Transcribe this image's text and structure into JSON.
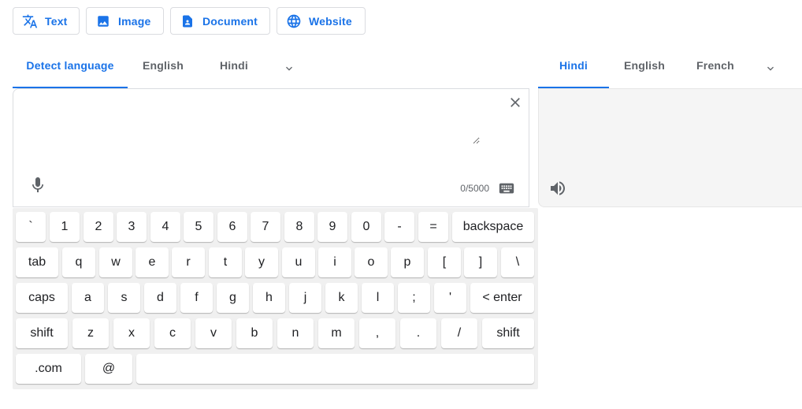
{
  "modes": [
    {
      "label": "Text",
      "icon": "translate-icon"
    },
    {
      "label": "Image",
      "icon": "image-icon"
    },
    {
      "label": "Document",
      "icon": "document-icon"
    },
    {
      "label": "Website",
      "icon": "globe-icon"
    }
  ],
  "source_tabs": [
    "Detect language",
    "English",
    "Hindi"
  ],
  "target_tabs": [
    "Hindi",
    "English",
    "French"
  ],
  "source": {
    "value": "",
    "counter": "0/5000"
  },
  "keyboard": {
    "row1": [
      "`",
      "1",
      "2",
      "3",
      "4",
      "5",
      "6",
      "7",
      "8",
      "9",
      "0",
      "-",
      "=",
      "backspace"
    ],
    "row2": [
      "tab",
      "q",
      "w",
      "e",
      "r",
      "t",
      "y",
      "u",
      "i",
      "o",
      "p",
      "[",
      "]",
      "\\"
    ],
    "row3": [
      "caps",
      "a",
      "s",
      "d",
      "f",
      "g",
      "h",
      "j",
      "k",
      "l",
      ";",
      "'",
      "< enter"
    ],
    "row4": [
      "shift",
      "z",
      "x",
      "c",
      "v",
      "b",
      "n",
      "m",
      ",",
      ".",
      "/",
      "shift"
    ],
    "row5": [
      ".com",
      "@",
      ""
    ]
  },
  "colors": {
    "accent": "#1a73e8",
    "tab_inactive": "#5f6368"
  }
}
